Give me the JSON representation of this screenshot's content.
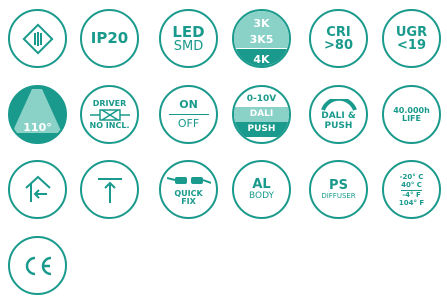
{
  "badges": {
    "class2": {
      "icon": "class2-double-square-icon"
    },
    "ip": {
      "text": "IP20"
    },
    "led": {
      "top": "LED",
      "bottom": "SMD"
    },
    "cct": {
      "a": "3K",
      "b": "3K5",
      "c": "4K"
    },
    "cri": {
      "top": "CRI",
      "bottom": ">80"
    },
    "ugr": {
      "top": "UGR",
      "bottom": "<19"
    },
    "beam": {
      "text": "110°"
    },
    "driver": {
      "top": "DRIVER",
      "bottom": "NO INCL."
    },
    "onoff": {
      "top": "ON",
      "bottom": "OFF"
    },
    "dim": {
      "a": "0-10V",
      "b": "DALI",
      "c": "PUSH"
    },
    "dali": {
      "top": "DALI &",
      "bottom": "PUSH"
    },
    "life": {
      "top": "40.000h",
      "bottom": "LIFE"
    },
    "wall": {
      "icon": "wall-mount-arrow-icon"
    },
    "ceiling": {
      "icon": "ceiling-mount-arrow-icon"
    },
    "quick": {
      "top": "QUICK",
      "bottom": "FIX"
    },
    "al": {
      "top": "AL",
      "bottom": "BODY"
    },
    "ps": {
      "top": "PS",
      "bottom": "DIFFUSER"
    },
    "temp": {
      "l1": "-20° C",
      "l2": "40° C",
      "l3": "-4° F",
      "l4": "104° F"
    },
    "ce": {
      "text": "CE"
    }
  },
  "colors": {
    "accent": "#1a9a8c",
    "light": "#8ad1c8"
  }
}
